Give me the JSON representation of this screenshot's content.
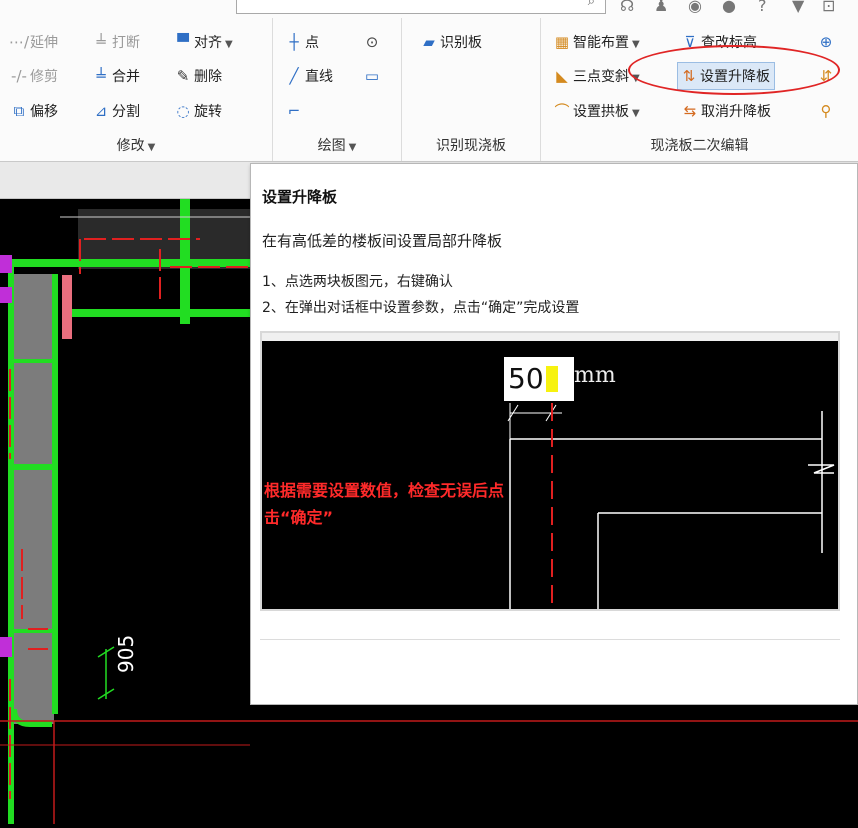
{
  "ribbon": {
    "modify": {
      "label": "修改",
      "tools": {
        "extend": "延伸",
        "break": "打断",
        "align": "对齐",
        "trim": "修剪",
        "merge": "合并",
        "delete": "删除",
        "offset": "偏移",
        "split": "分割",
        "rotate": "旋转"
      }
    },
    "draw": {
      "label": "绘图",
      "tools": {
        "point": "点",
        "line": "直线"
      }
    },
    "recognize": {
      "label": "识别现浇板",
      "tools": {
        "recognize_slab": "识别板"
      }
    },
    "edit": {
      "label": "现浇板二次编辑",
      "tools": {
        "smart_layout": "智能布置",
        "check_elevation": "查改标高",
        "three_point_slope": "三点变斜",
        "set_raise_lower": "设置升降板",
        "set_arch": "设置拱板",
        "cancel_raise_lower": "取消升降板"
      }
    }
  },
  "canvas": {
    "dimension_905": "905"
  },
  "tooltip": {
    "title": "设置升降板",
    "description": "在有高低差的楼板间设置局部升降板",
    "steps": [
      "1、点选两块板图元，右键确认",
      "2、在弹出对话框中设置参数，点击“确定”完成设置"
    ],
    "illustration": {
      "value": "50",
      "unit": "mm",
      "note": "根据需要设置数值，检查无误后点击“确定”"
    }
  },
  "colors": {
    "highlight_oval": "#e02525",
    "cad_green": "#22dd22",
    "cad_red": "#e02020",
    "note_red": "#ff2a2a"
  }
}
